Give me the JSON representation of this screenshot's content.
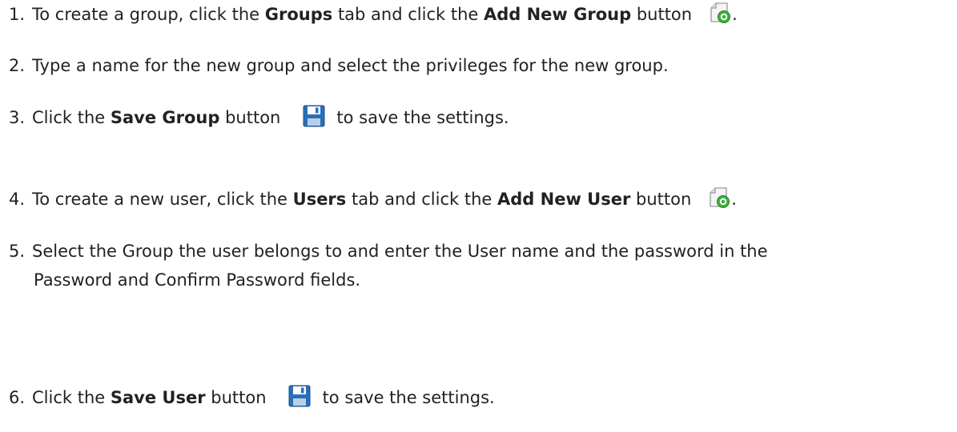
{
  "steps": [
    {
      "number": "1.",
      "text_before": "To create a group, click the ",
      "bold1": "Groups",
      "text_middle": " tab and click the ",
      "bold2": "Add New Group",
      "text_after": " button",
      "trailing": ".",
      "icon": "add-new-icon"
    },
    {
      "number": "2.",
      "text": "Type a name for the new group and select the privileges for the new group."
    },
    {
      "number": "3.",
      "text_before": "Click the ",
      "bold1": "Save Group",
      "text_after": " button",
      "text_end": "to save the settings.",
      "icon": "save-disk-icon"
    },
    {
      "number": "4.",
      "text_before": "To create a new user, click the ",
      "bold1": "Users",
      "text_middle": " tab and click the ",
      "bold2": "Add New User",
      "text_after": " button",
      "trailing": ".",
      "icon": "add-new-icon"
    },
    {
      "number": "5.",
      "line1": "Select the Group the user belongs to and enter the User name and the password in the",
      "line2": "Password and Confirm Password fields."
    },
    {
      "number": "6.",
      "text_before": "Click the ",
      "bold1": "Save User",
      "text_after": " button",
      "text_end": "to save the settings.",
      "icon": "save-disk-icon"
    }
  ],
  "colors": {
    "text": "#222222",
    "save_icon_blue": "#2a6fb8",
    "add_icon_green": "#3fae3a"
  }
}
